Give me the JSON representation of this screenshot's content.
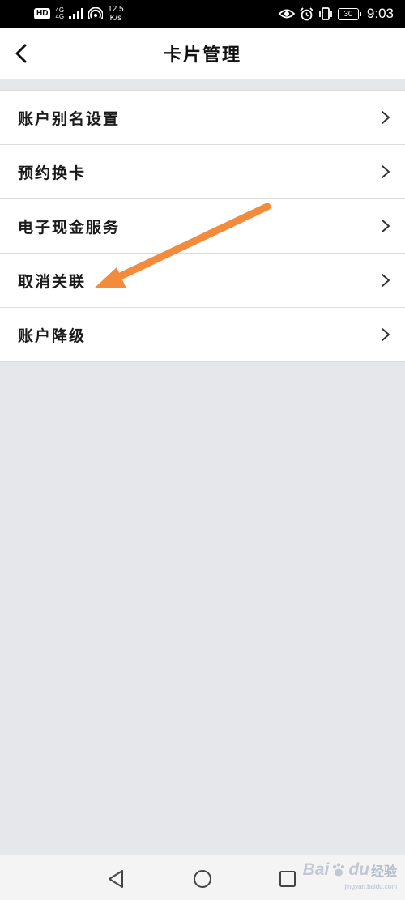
{
  "status_bar": {
    "hd": "HD",
    "net_top": "4G",
    "net_bottom": "4G",
    "speed_value": "12.5",
    "speed_unit": "K/s",
    "battery": "30",
    "time": "9:03"
  },
  "header": {
    "title": "卡片管理"
  },
  "menu": {
    "items": [
      {
        "label": "账户别名设置"
      },
      {
        "label": "预约换卡"
      },
      {
        "label": "电子现金服务"
      },
      {
        "label": "取消关联"
      },
      {
        "label": "账户降级"
      }
    ]
  },
  "annotation": {
    "color": "#f28c3c"
  },
  "watermark": {
    "brand": "Bai",
    "brand2": "du",
    "cn": "经验",
    "url": "jingyan.baidu.com"
  }
}
